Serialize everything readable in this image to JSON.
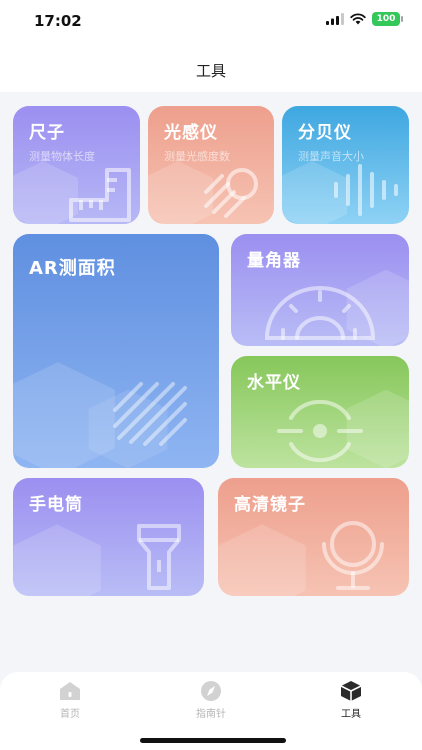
{
  "status_bar": {
    "time": "17:02",
    "battery": "100"
  },
  "header": {
    "title": "工具"
  },
  "tools": {
    "ruler": {
      "title": "尺子",
      "subtitle": "测量物体长度"
    },
    "light_meter": {
      "title": "光感仪",
      "subtitle": "测量光感度数"
    },
    "decibel_meter": {
      "title": "分贝仪",
      "subtitle": "测量声音大小"
    },
    "ar_area": {
      "title": "AR测面积"
    },
    "protractor": {
      "title": "量角器"
    },
    "level": {
      "title": "水平仪"
    },
    "flashlight": {
      "title": "手电筒"
    },
    "hd_mirror": {
      "title": "高清镜子"
    }
  },
  "tabbar": {
    "items": [
      {
        "label": "首页",
        "active": false
      },
      {
        "label": "指南针",
        "active": false
      },
      {
        "label": "工具",
        "active": true
      }
    ]
  },
  "colors": {
    "purple": "#9b8ff0",
    "salmon": "#ee9f8d",
    "blue": "#3ea7e0",
    "ar_blue": "#5f8fe0",
    "green": "#86c75a",
    "battery": "#34c759"
  }
}
